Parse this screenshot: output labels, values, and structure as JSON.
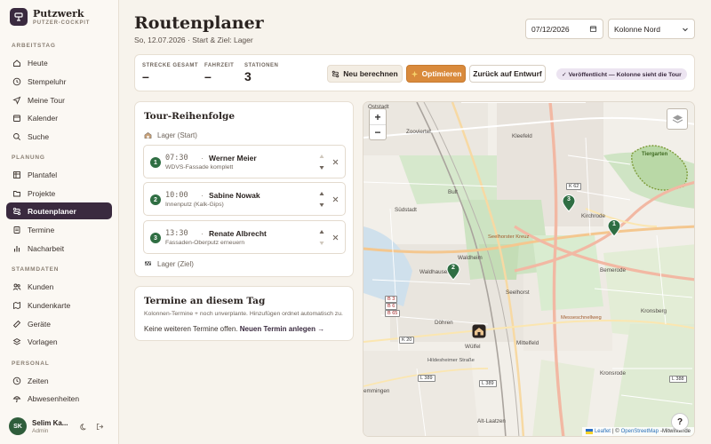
{
  "brand": {
    "title": "Putzwerk",
    "subtitle": "PUTZER-COCKPIT"
  },
  "sidebar": {
    "sections": [
      {
        "label": "ARBEITSTAG",
        "items": [
          {
            "label": "Heute",
            "icon": "home-icon"
          },
          {
            "label": "Stempeluhr",
            "icon": "clock-icon"
          },
          {
            "label": "Meine Tour",
            "icon": "navigation-icon"
          },
          {
            "label": "Kalender",
            "icon": "calendar-icon"
          },
          {
            "label": "Suche",
            "icon": "search-icon"
          }
        ]
      },
      {
        "label": "PLANUNG",
        "items": [
          {
            "label": "Plantafel",
            "icon": "grid-icon"
          },
          {
            "label": "Projekte",
            "icon": "folder-icon"
          },
          {
            "label": "Routenplaner",
            "icon": "route-icon",
            "active": true
          },
          {
            "label": "Termine",
            "icon": "document-icon"
          },
          {
            "label": "Nacharbeit",
            "icon": "bars-icon"
          }
        ]
      },
      {
        "label": "STAMMDATEN",
        "items": [
          {
            "label": "Kunden",
            "icon": "users-icon"
          },
          {
            "label": "Kundenkarte",
            "icon": "map-icon"
          },
          {
            "label": "Geräte",
            "icon": "tool-icon"
          },
          {
            "label": "Vorlagen",
            "icon": "layers-icon"
          }
        ]
      },
      {
        "label": "PERSONAL",
        "items": [
          {
            "label": "Zeiten",
            "icon": "clock-icon"
          },
          {
            "label": "Abwesenheiten",
            "icon": "umbrella-icon"
          }
        ]
      }
    ]
  },
  "user": {
    "initials": "SK",
    "name": "Selim Ka...",
    "role": "Admin"
  },
  "header": {
    "title": "Routenplaner",
    "subtitle": "So, 12.07.2026 · Start & Ziel: Lager",
    "date_value": "07/12/2026",
    "column_select": "Kolonne Nord"
  },
  "stats": {
    "distance_label": "STRECKE GESAMT",
    "distance_value": "–",
    "drive_label": "FAHRZEIT",
    "drive_value": "–",
    "stations_label": "STATIONEN",
    "stations_value": "3",
    "recalc_label": "Neu berechnen",
    "optimize_label": "Optimieren",
    "draft_label": "Zurück auf Entwurf",
    "published_badge": "✓ Veröffentlicht — Kolonne sieht die Tour"
  },
  "tour": {
    "title": "Tour-Reihenfolge",
    "start_label": "Lager (Start)",
    "end_label": "Lager (Ziel)",
    "stops": [
      {
        "num": "1",
        "time": "07:30",
        "name": "Werner Meier",
        "desc": "WDVS-Fassade komplett"
      },
      {
        "num": "2",
        "time": "10:00",
        "name": "Sabine Nowak",
        "desc": "Innenputz (Kalk-Gips)"
      },
      {
        "num": "3",
        "time": "13:30",
        "name": "Renate Albrecht",
        "desc": "Fassaden-Oberputz erneuern"
      }
    ]
  },
  "termine": {
    "title": "Termine an diesem Tag",
    "hint": "Kolonnen-Termine + noch unverplante. Hinzufügen ordnet automatisch zu.",
    "empty_text": "Keine weiteren Termine offen.",
    "new_link": "Neuen Termin anlegen →"
  },
  "map": {
    "zoom_in": "+",
    "zoom_out": "−",
    "attribution_leaflet": "Leaflet",
    "attribution_sep": "| ©",
    "attribution_osm": "OpenStreetMap",
    "attribution_rest": "-Mitwirkende",
    "help": "?",
    "labels": {
      "oststadt": "Oststadt",
      "zooviertel": "Zooviertel",
      "kleefeld": "Kleefeld",
      "tiergarten": "Tiergarten",
      "bult": "Bult",
      "suedstadt": "Südstadt",
      "kirchrode": "Kirchrode",
      "bemerode": "Bemerode",
      "waldheim": "Waldheim",
      "waldhausen": "Waldhausen",
      "seelhorst": "Seelhorst",
      "doehren": "Döhren",
      "mittelfeld": "Mittelfeld",
      "kronsberg": "Kronsberg",
      "wuelfel": "Wülfel",
      "kronsrode": "Kronsrode",
      "emmingen": "emmingen",
      "altlaatzen": "Alt-Laatzen",
      "seelhorster_kreuz": "Seelhorster Kreuz",
      "messeschnellweg": "Messeschnellweg",
      "hildesheimer": "Hildesheimer Straße",
      "k62": "K 62",
      "k20": "K 20",
      "l389": "L 389",
      "l389b": "L 389",
      "l388": "L 388",
      "b3": "B 3",
      "b6": "B 6",
      "b65": "B 65"
    },
    "pins": [
      "1",
      "2",
      "3"
    ]
  },
  "colors": {
    "accent": "#3a2a3f",
    "primary_button": "#d98a3c",
    "stop_green": "#2f6e43",
    "badge_bg": "#ece4f1"
  }
}
